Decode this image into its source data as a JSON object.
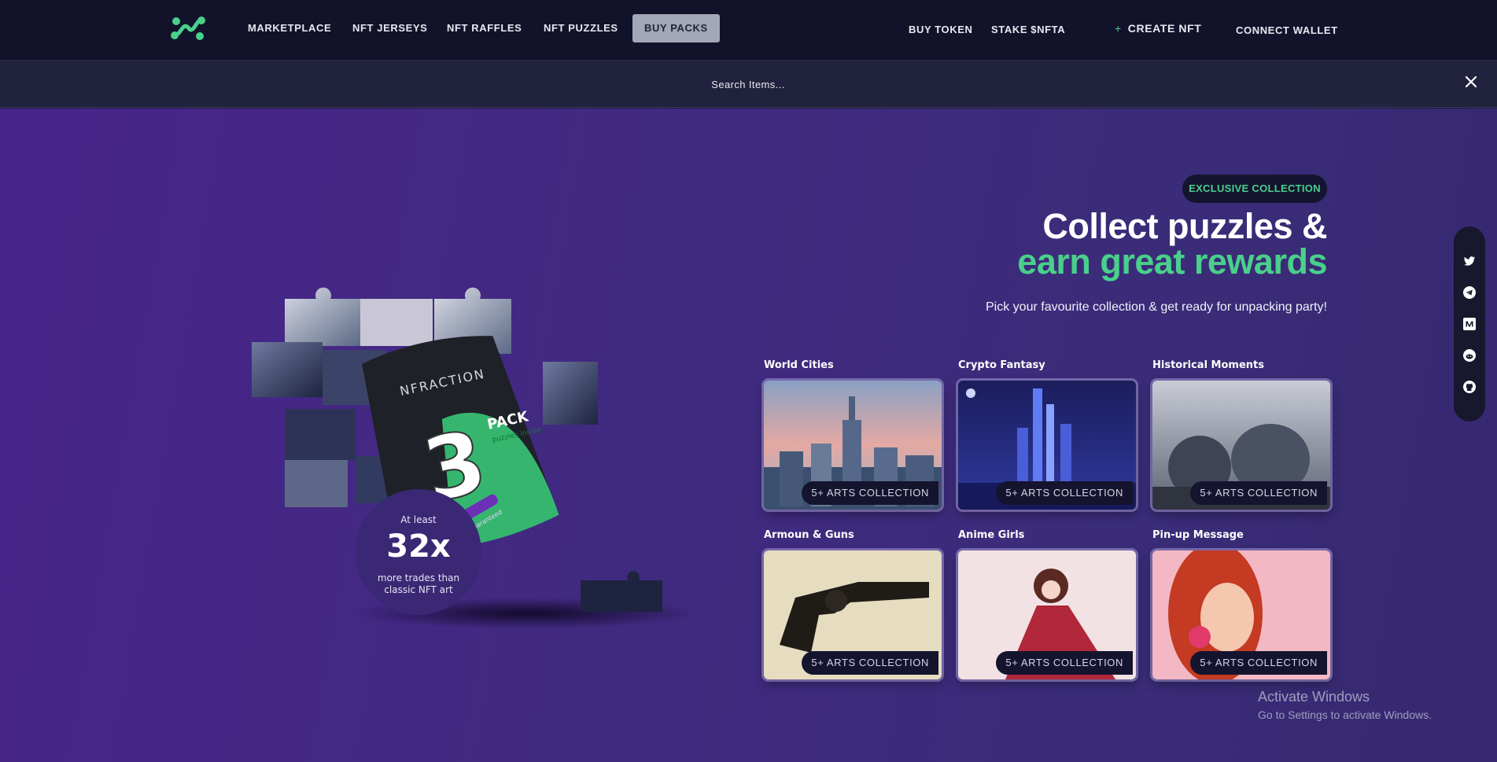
{
  "nav": {
    "links": [
      "MARKETPLACE",
      "NFT JERSEYS",
      "NFT RAFFLES",
      "NFT PUZZLES",
      "BUY PACKS"
    ],
    "active": "BUY PACKS",
    "right_links": [
      "BUY TOKEN",
      "STAKE $NFTA"
    ],
    "create_label": "CREATE NFT",
    "connect_label": "CONNECT WALLET"
  },
  "search": {
    "placeholder": "Search Items..."
  },
  "hero": {
    "pill": "EXCLUSIVE COLLECTION",
    "headline_line1": "Collect puzzles &",
    "headline_line2": "earn great rewards",
    "subhead": "Pick your favourite collection & get ready for unpacking party!"
  },
  "pack_badge": {
    "top": "At least",
    "big": "32x",
    "bottom": "more trades than classic NFT art"
  },
  "pack_print": {
    "brand": "NFRACTION",
    "number": "3",
    "word": "PACK",
    "small": "puzzles inside",
    "ribbon": "TIER 4 piece guaranteed"
  },
  "collections": [
    {
      "title": "World Cities",
      "tag": "5+ ARTS COLLECTION"
    },
    {
      "title": "Crypto Fantasy",
      "tag": "5+ ARTS COLLECTION"
    },
    {
      "title": "Historical Moments",
      "tag": "5+ ARTS COLLECTION"
    },
    {
      "title": "Armoun & Guns",
      "tag": "5+ ARTS COLLECTION"
    },
    {
      "title": "Anime Girls",
      "tag": "5+ ARTS COLLECTION"
    },
    {
      "title": "Pin-up Message",
      "tag": "5+ ARTS COLLECTION"
    }
  ],
  "social_icons": [
    "twitter-icon",
    "telegram-icon",
    "medium-icon",
    "reddit-icon",
    "github-icon"
  ],
  "watermark": {
    "line1": "Activate Windows",
    "line2": "Go to Settings to activate Windows."
  },
  "colors": {
    "accent_green": "#49d08a",
    "nav_bg": "#12132a",
    "hero_purple": "#48248a"
  }
}
